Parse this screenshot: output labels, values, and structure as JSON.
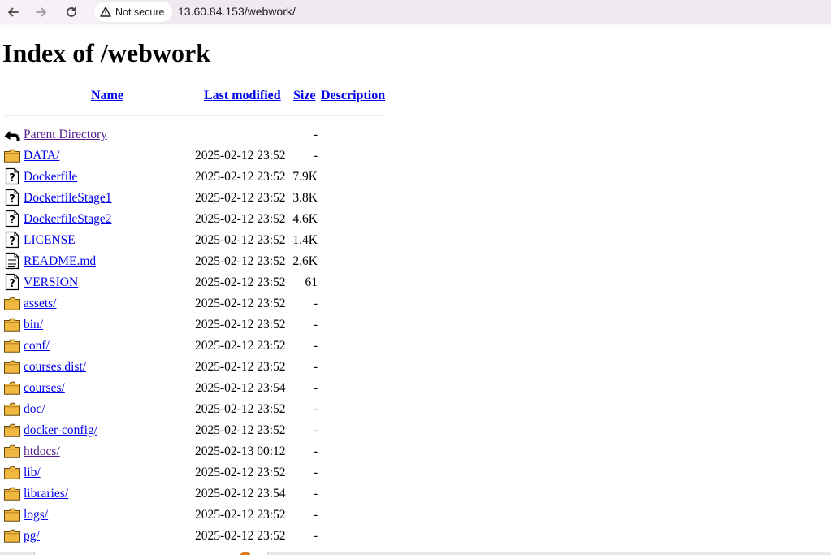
{
  "browser": {
    "security_label": "Not secure",
    "url": "13.60.84.153/webwork/"
  },
  "page": {
    "title": "Index of /webwork",
    "columns": {
      "name": "Name",
      "last_modified": "Last modified",
      "size": "Size",
      "description": "Description"
    }
  },
  "entries": [
    {
      "icon": "back-icon",
      "name": "Parent Directory",
      "date": "",
      "size": "-",
      "visited": true
    },
    {
      "icon": "folder-icon",
      "name": "DATA/",
      "date": "2025-02-12 23:52",
      "size": "-",
      "visited": false
    },
    {
      "icon": "unknown-file-icon",
      "name": "Dockerfile",
      "date": "2025-02-12 23:52",
      "size": "7.9K",
      "visited": false
    },
    {
      "icon": "unknown-file-icon",
      "name": "DockerfileStage1",
      "date": "2025-02-12 23:52",
      "size": "3.8K",
      "visited": false
    },
    {
      "icon": "unknown-file-icon",
      "name": "DockerfileStage2",
      "date": "2025-02-12 23:52",
      "size": "4.6K",
      "visited": false
    },
    {
      "icon": "unknown-file-icon",
      "name": "LICENSE",
      "date": "2025-02-12 23:52",
      "size": "1.4K",
      "visited": false
    },
    {
      "icon": "text-file-icon",
      "name": "README.md",
      "date": "2025-02-12 23:52",
      "size": "2.6K",
      "visited": false
    },
    {
      "icon": "unknown-file-icon",
      "name": "VERSION",
      "date": "2025-02-12 23:52",
      "size": "61",
      "visited": false
    },
    {
      "icon": "folder-icon",
      "name": "assets/",
      "date": "2025-02-12 23:52",
      "size": "-",
      "visited": false
    },
    {
      "icon": "folder-icon",
      "name": "bin/",
      "date": "2025-02-12 23:52",
      "size": "-",
      "visited": false
    },
    {
      "icon": "folder-icon",
      "name": "conf/",
      "date": "2025-02-12 23:52",
      "size": "-",
      "visited": false
    },
    {
      "icon": "folder-icon",
      "name": "courses.dist/",
      "date": "2025-02-12 23:52",
      "size": "-",
      "visited": false
    },
    {
      "icon": "folder-icon",
      "name": "courses/",
      "date": "2025-02-12 23:54",
      "size": "-",
      "visited": false
    },
    {
      "icon": "folder-icon",
      "name": "doc/",
      "date": "2025-02-12 23:52",
      "size": "-",
      "visited": false
    },
    {
      "icon": "folder-icon",
      "name": "docker-config/",
      "date": "2025-02-12 23:52",
      "size": "-",
      "visited": false
    },
    {
      "icon": "folder-icon",
      "name": "htdocs/",
      "date": "2025-02-13 00:12",
      "size": "-",
      "visited": true
    },
    {
      "icon": "folder-icon",
      "name": "lib/",
      "date": "2025-02-12 23:52",
      "size": "-",
      "visited": false
    },
    {
      "icon": "folder-icon",
      "name": "libraries/",
      "date": "2025-02-12 23:54",
      "size": "-",
      "visited": false
    },
    {
      "icon": "folder-icon",
      "name": "logs/",
      "date": "2025-02-12 23:52",
      "size": "-",
      "visited": false
    },
    {
      "icon": "folder-icon",
      "name": "pg/",
      "date": "2025-02-12 23:52",
      "size": "-",
      "visited": false
    }
  ],
  "colors": {
    "link": "#0000ee",
    "visited_link": "#551a8b",
    "folder": "#f0b840"
  }
}
